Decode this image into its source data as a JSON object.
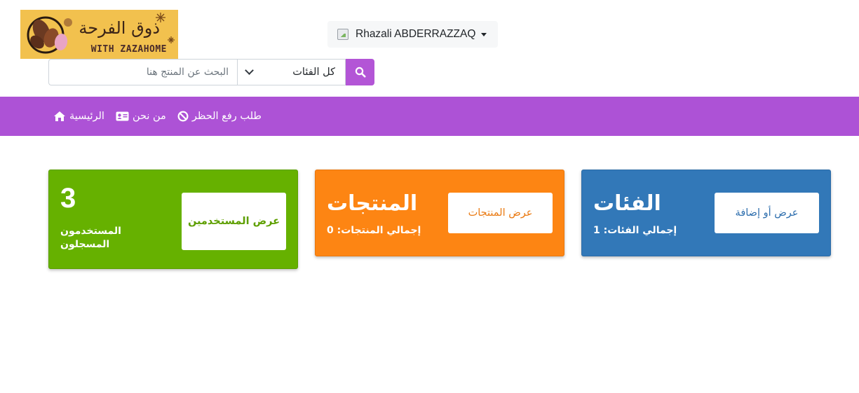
{
  "logo": {
    "arabic_text": "ذوق الفرحة",
    "english_text": "WITH ZAZAHOME"
  },
  "user": {
    "name": "Rhazali ABDERRAZZAQ"
  },
  "search": {
    "placeholder": "البحث عن المنتج هنا",
    "category_selected": "كل الفئات",
    "button_icon": "search-icon"
  },
  "nav": {
    "items": [
      {
        "label": "الرئيسية",
        "icon": "home-icon"
      },
      {
        "label": "من نحن",
        "icon": "id-card-icon"
      },
      {
        "label": "طلب رفع الحظر",
        "icon": "ban-icon"
      }
    ]
  },
  "cards": {
    "users": {
      "count": "3",
      "subtitle": "المستخدمون المسجلون",
      "button": "عرض المستخدمين",
      "color": "#66b100"
    },
    "products": {
      "title": "المنتجات",
      "subtitle": "إجمالي المنتجات: 0",
      "button": "عرض المنتجات",
      "color": "#fd8513"
    },
    "categories": {
      "title": "الفئات",
      "subtitle": "إجمالي الفئات: 1",
      "button": "عرض أو إضافة",
      "color": "#3278b8"
    }
  },
  "colors": {
    "navbar": "#ad52d6",
    "search_button": "#b355d6"
  }
}
